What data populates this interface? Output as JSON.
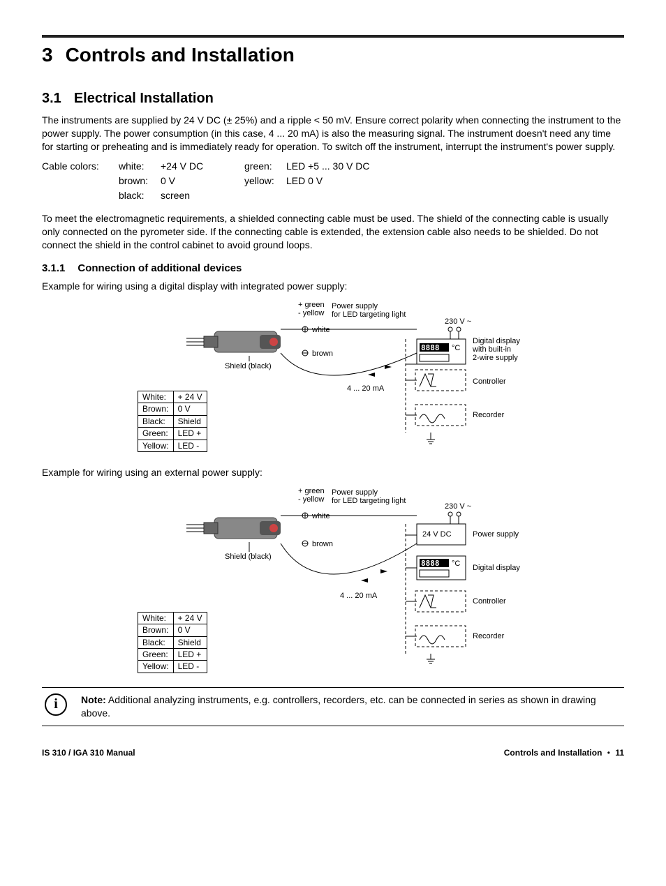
{
  "chapter": {
    "num": "3",
    "title": "Controls and Installation"
  },
  "s31": {
    "num": "3.1",
    "title": "Electrical Installation",
    "p1": "The instruments are supplied by 24 V DC (± 25%) and a ripple < 50 mV. Ensure correct polarity when connecting the instrument to the power supply. The power consumption (in this case, 4 ... 20 mA) is also the measuring signal. The instrument doesn't need any time for starting or preheating and is immediately ready for operation. To switch off the instrument, interrupt the instrument's power supply.",
    "cable_label": "Cable colors:",
    "cables": {
      "white_l": "white:",
      "white_v": "+24 V DC",
      "brown_l": "brown:",
      "brown_v": "0 V",
      "black_l": "black:",
      "black_v": "screen",
      "green_l": "green:",
      "green_v": "LED +5 ... 30 V DC",
      "yellow_l": "yellow:",
      "yellow_v": "LED 0 V"
    },
    "p2": "To meet the electromagnetic requirements, a shielded connecting cable must be used. The shield of the connecting cable is usually only connected on the pyrometer side. If the connecting cable is extended, the extension cable also needs to be shielded. Do not connect the shield in the control cabinet to avoid ground loops."
  },
  "s311": {
    "num": "3.1.1",
    "title": "Connection of additional devices",
    "caption1": "Example for wiring using a digital display with integrated power supply:",
    "caption2": "Example for wiring using an external power supply:"
  },
  "diagram_common": {
    "plus_green": "+ green",
    "minus_yellow": "- yellow",
    "ps_led_l1": "Power supply",
    "ps_led_l2": "for LED targeting light",
    "white_plus": "white",
    "brown_minus": "brown",
    "shield_black": "Shield (black)",
    "signal": "4 ... 20 mA",
    "v230": "230 V ~",
    "seg": "8888",
    "degc": "°C"
  },
  "diagram1_labels": {
    "dd1": "Digital display",
    "dd2": "with built-in",
    "dd3": "2-wire supply",
    "controller": "Controller",
    "recorder": "Recorder"
  },
  "diagram2_labels": {
    "ps": "Power supply",
    "v24": "24 V DC",
    "dd": "Digital display",
    "controller": "Controller",
    "recorder": "Recorder"
  },
  "wire_table": {
    "rows": [
      {
        "c": "White:",
        "v": "+ 24 V"
      },
      {
        "c": "Brown:",
        "v": "0 V"
      },
      {
        "c": "Black:",
        "v": "Shield"
      },
      {
        "c": "Green:",
        "v": "LED +"
      },
      {
        "c": "Yellow:",
        "v": "LED -"
      }
    ]
  },
  "note": {
    "label": "Note:",
    "text": " Additional analyzing instruments, e.g. controllers, recorders, etc. can be connected in series as shown in drawing above."
  },
  "footer": {
    "left": "IS 310 / IGA 310 Manual",
    "right_label": "Controls and Installation",
    "bullet": "•",
    "page": "11"
  }
}
